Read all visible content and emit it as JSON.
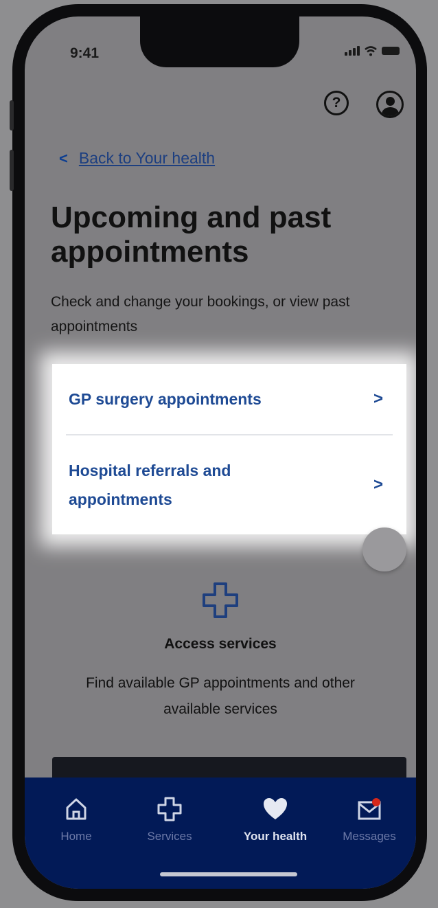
{
  "status_bar": {
    "time": "9:41"
  },
  "header": {
    "help_icon": "question-circle-icon",
    "help_glyph": "?",
    "account_icon": "user-circle-icon"
  },
  "back_link": {
    "label": "Back to Your health",
    "icon": "chevron-left-icon",
    "glyph": "<"
  },
  "page": {
    "title": "Upcoming and past appointments",
    "subtitle": "Check and change your bookings, or view past appointments"
  },
  "appointments_menu": {
    "items": [
      {
        "label": "GP surgery appointments",
        "glyph": ">"
      },
      {
        "label": "Hospital referrals and appointments",
        "glyph": ">"
      }
    ]
  },
  "access_services": {
    "icon": "plus-outline-icon",
    "title": "Access services",
    "description": "Find available GP appointments and other available services"
  },
  "bottom_nav": {
    "items": [
      {
        "label": "Home",
        "icon": "home-icon"
      },
      {
        "label": "Services",
        "icon": "plus-icon"
      },
      {
        "label": "Your health",
        "icon": "heart-icon",
        "active": true
      },
      {
        "label": "Messages",
        "icon": "envelope-notification-icon"
      }
    ]
  },
  "colors": {
    "nhs_blue": "#1e4a94",
    "nav_background": "#021a57",
    "notification_red": "#d5281b"
  }
}
